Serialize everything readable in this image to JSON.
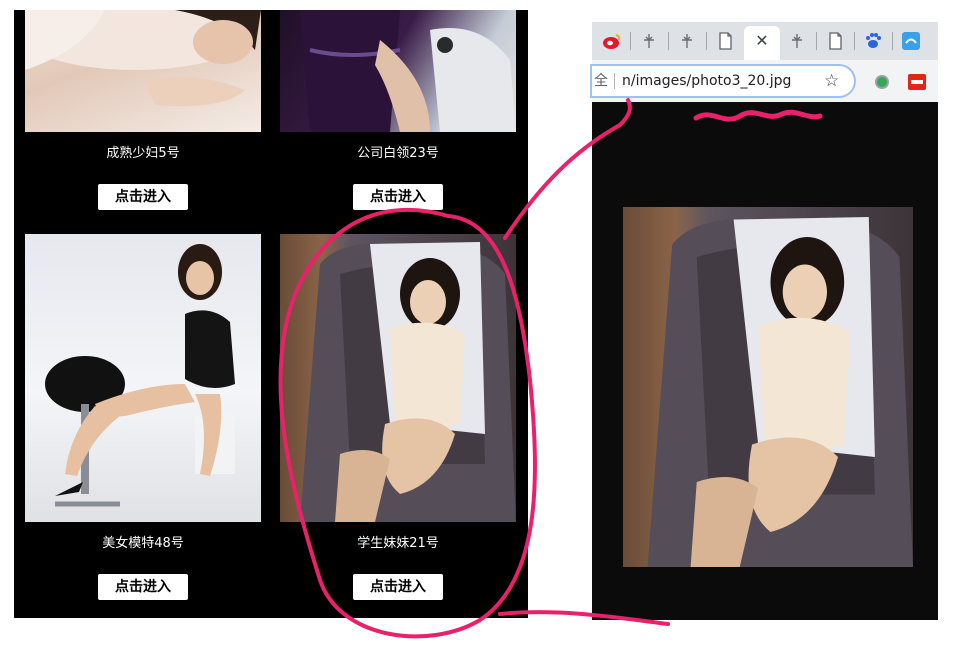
{
  "gallery": {
    "cards": [
      {
        "caption": "成熟少妇5号",
        "button_label": "点击进入"
      },
      {
        "caption": "公司白领23号",
        "button_label": "点击进入"
      },
      {
        "caption": "美女模特48号",
        "button_label": "点击进入"
      },
      {
        "caption": "学生妹妹21号",
        "button_label": "点击进入"
      }
    ]
  },
  "browser": {
    "tabs": [
      {
        "icon": "weibo-icon"
      },
      {
        "icon": "thunder-icon"
      },
      {
        "icon": "thunder-icon"
      },
      {
        "icon": "page-icon"
      },
      {
        "icon": "close-icon",
        "glyph": "✕",
        "active": true
      },
      {
        "icon": "thunder-icon"
      },
      {
        "icon": "page-icon"
      },
      {
        "icon": "paw-icon"
      },
      {
        "icon": "app-icon"
      }
    ],
    "omnibox": {
      "security_label": "全",
      "url": "n/images/photo3_20.jpg",
      "bookmark_glyph": "☆"
    },
    "extensions": [
      "green-circle-icon",
      "red-extension-icon"
    ]
  },
  "colors": {
    "annotation": "#e8216a",
    "gallery_bg": "#000000",
    "viewer_bg": "#0b0b0b",
    "omnibox_focus": "#9ec1f5"
  }
}
